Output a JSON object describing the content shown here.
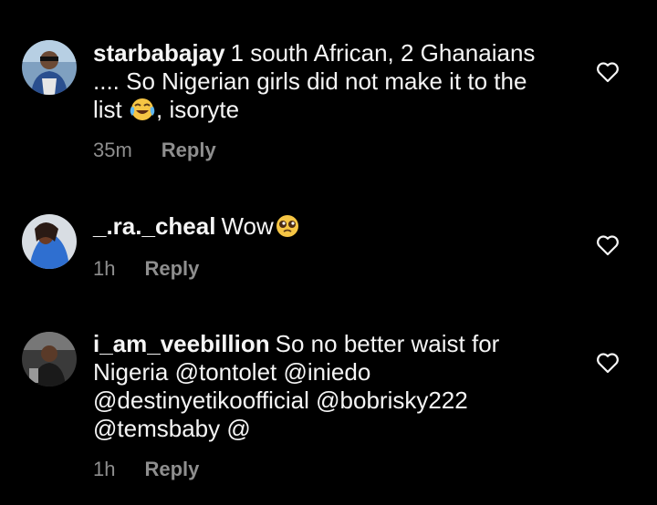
{
  "comments": [
    {
      "username": "starbabajay",
      "text_before": "1 south African, 2 Ghanaians .... So Nigerian girls did not make it to the list",
      "emoji": "face-with-tears-of-joy",
      "text_after": ", isoryte",
      "time": "35m",
      "reply": "Reply"
    },
    {
      "username": "_.ra._cheal",
      "text_before": "Wow",
      "emoji": "pleading-face",
      "text_after": "",
      "time": "1h",
      "reply": "Reply"
    },
    {
      "username": "i_am_veebillion",
      "text_before": "So no better waist for Nigeria @tontolet @iniedo @destinyetikoofficial @bobrisky222 @temsbaby @",
      "text_after": "",
      "time": "1h",
      "reply": "Reply"
    }
  ],
  "icons": {
    "like": "heart-outline-icon"
  },
  "colors": {
    "background": "#000000",
    "text": "#f5f5f5",
    "muted": "#8e8e8e"
  }
}
